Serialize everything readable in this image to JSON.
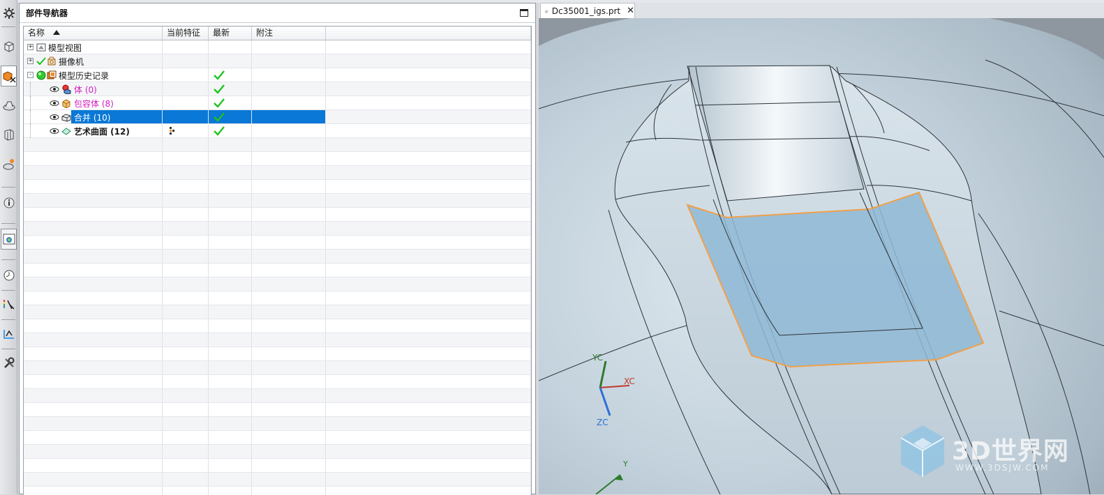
{
  "navigator": {
    "title": "部件导航器",
    "columns": [
      "名称",
      "当前特征",
      "最新",
      "附注"
    ],
    "rows": [
      {
        "name": "模型视图",
        "style": "normal",
        "level": 0,
        "expander": "+",
        "latest": false,
        "icon": "model-views-icon"
      },
      {
        "name": "摄像机",
        "style": "normal",
        "level": 0,
        "expander": "+",
        "latest": false,
        "icon": "camera-icon"
      },
      {
        "name": "模型历史记录",
        "style": "normal",
        "level": 0,
        "expander": "-",
        "latest": true,
        "icon": "history-icon"
      },
      {
        "name": "体 (0)",
        "style": "pink",
        "level": 1,
        "latest": true,
        "icon": "body-icon"
      },
      {
        "name": "包容体 (8)",
        "style": "pink",
        "level": 1,
        "latest": true,
        "icon": "bounding-body-icon"
      },
      {
        "name": "合并 (10)",
        "style": "selected",
        "level": 1,
        "latest": true,
        "icon": "unite-icon"
      },
      {
        "name": "艺术曲面 (12)",
        "style": "bold",
        "level": 1,
        "latest": true,
        "current": true,
        "icon": "studio-surface-icon"
      }
    ]
  },
  "viewport": {
    "tab_label": "Dc35001_igs.prt",
    "tab_close": "✕",
    "triad": {
      "x": "XC",
      "y": "YC",
      "z": "ZC"
    },
    "abs_y": "Y",
    "watermark_main": "3D世界网",
    "watermark_sub": "WWW.3DSJW.COM"
  },
  "colors": {
    "selection": "#0a78d6",
    "check": "#1fc31f",
    "highlight_edge": "#f0a04a",
    "surface": "#b9cad6"
  }
}
